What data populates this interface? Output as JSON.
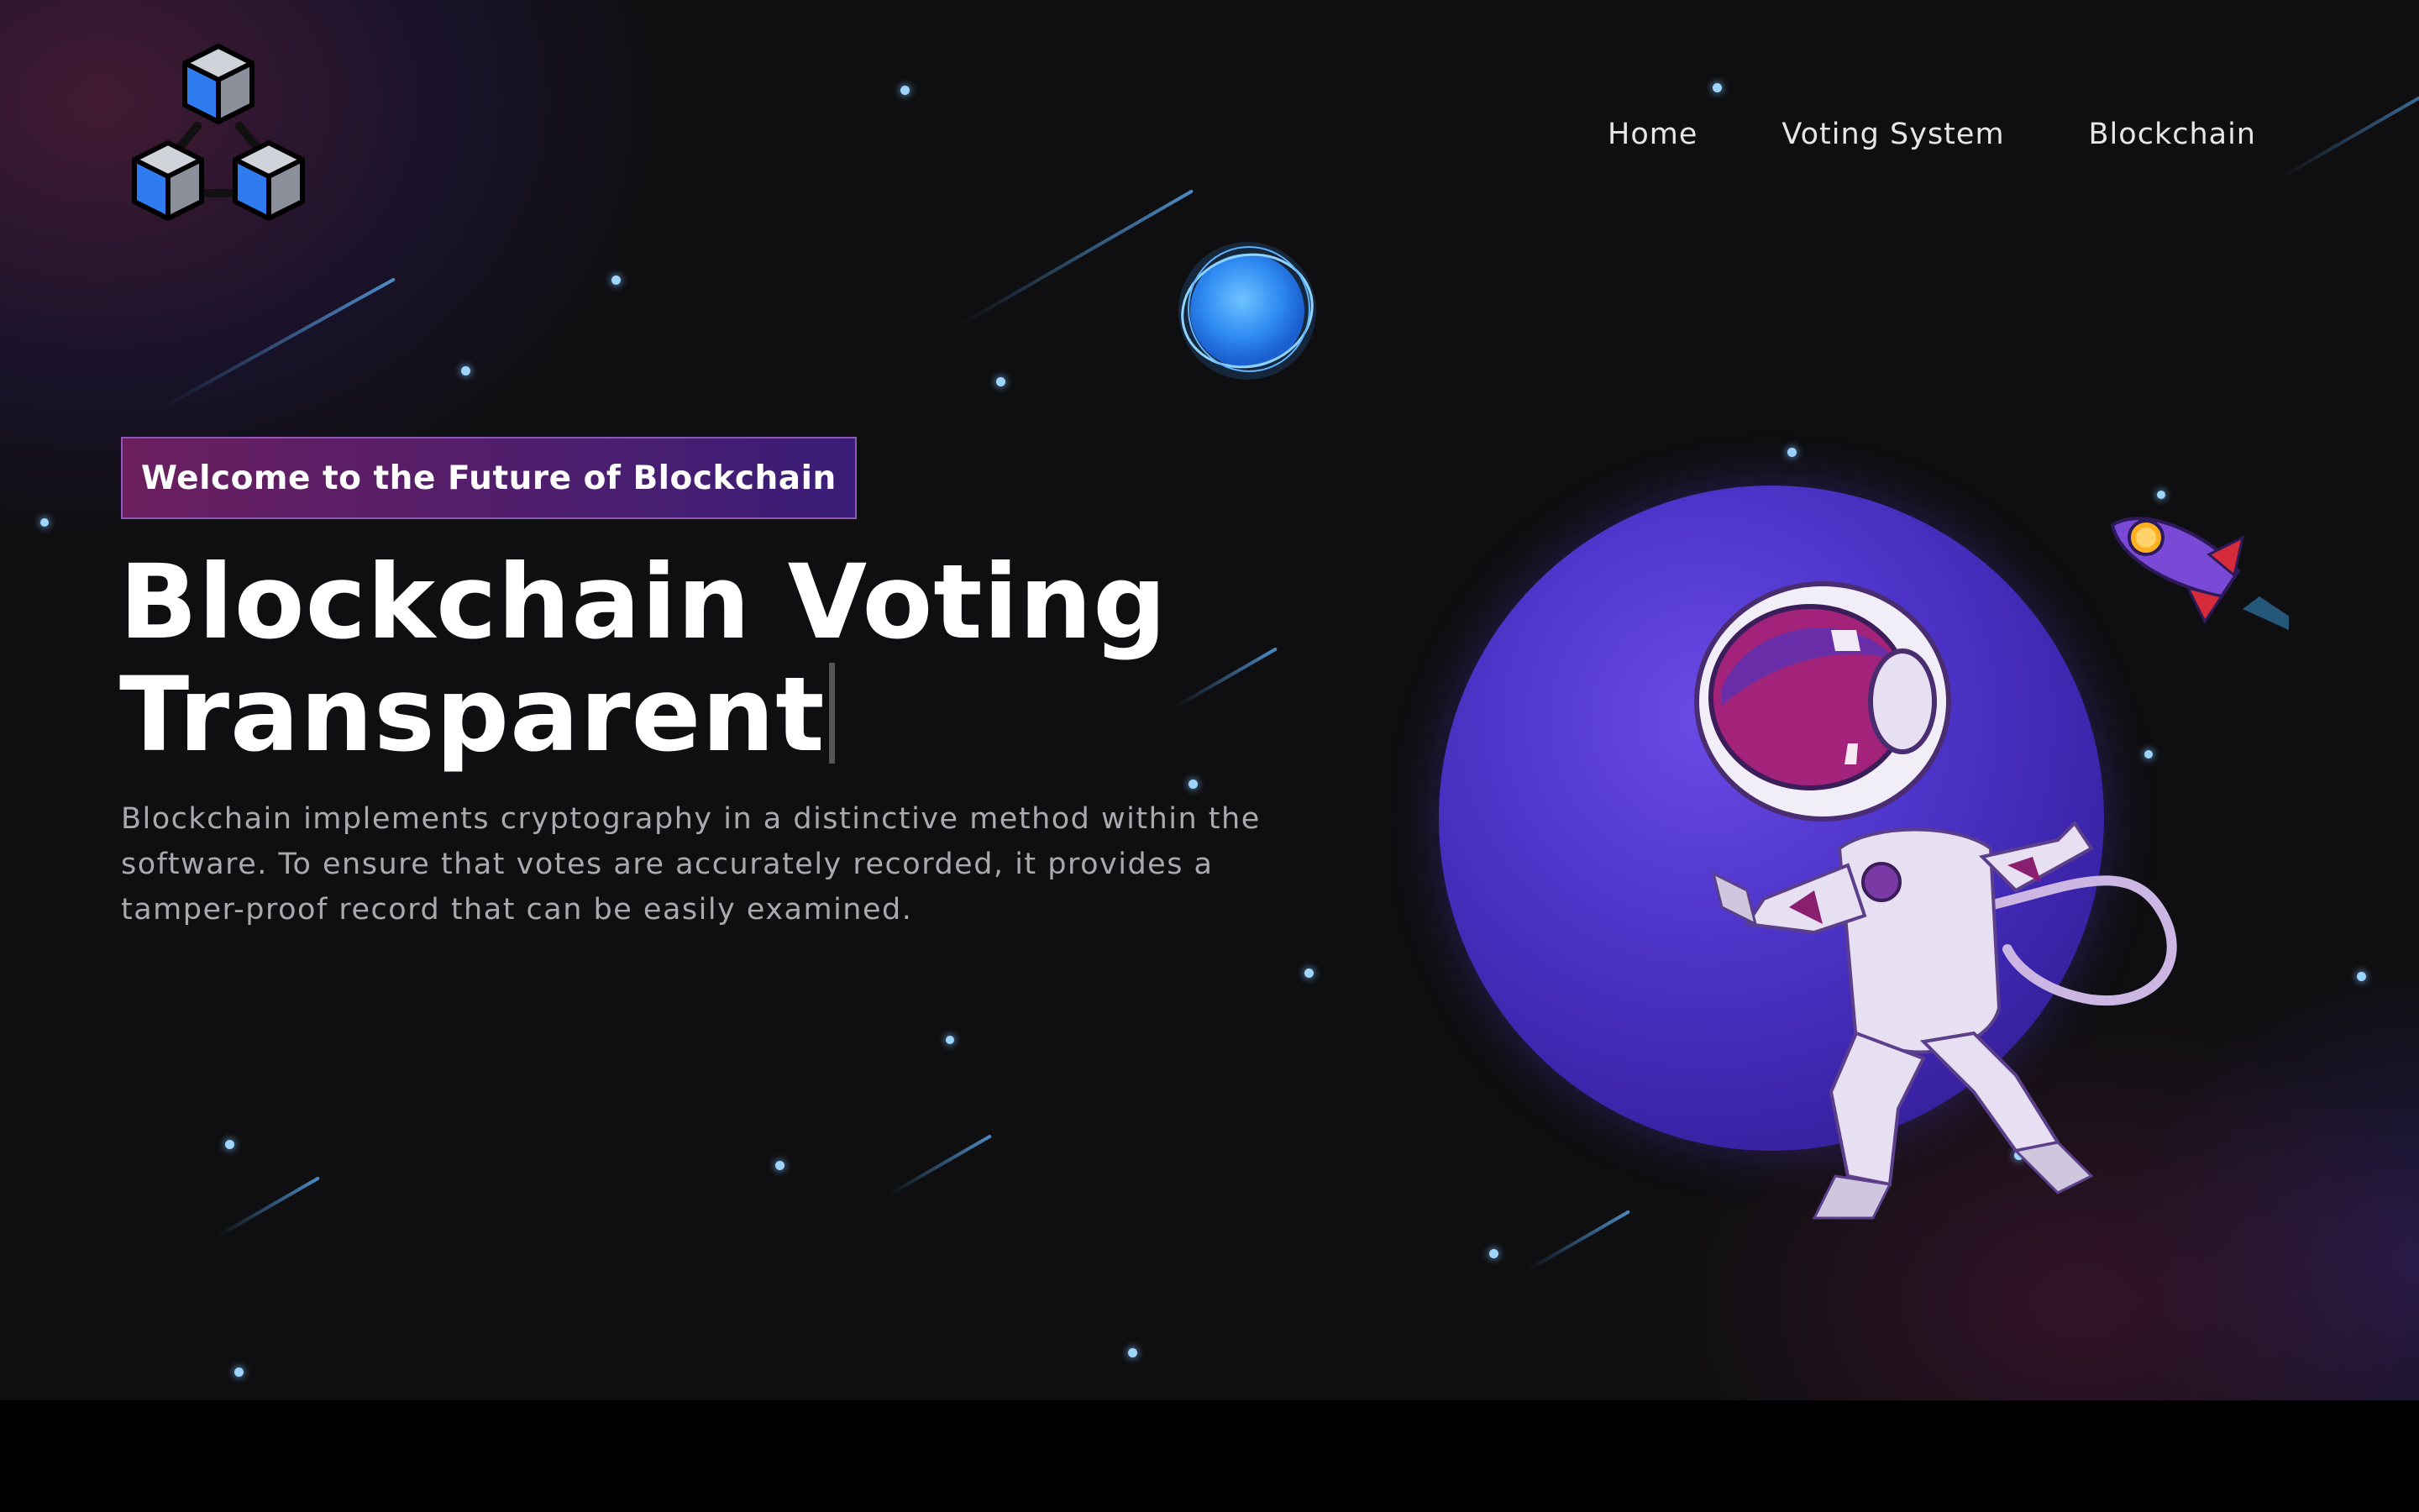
{
  "nav": {
    "items": [
      {
        "label": "Home"
      },
      {
        "label": "Voting System"
      },
      {
        "label": "Blockchain"
      }
    ]
  },
  "hero": {
    "badge": "Welcome to the Future of Blockchain",
    "title_line1": "Blockchain Voting",
    "title_line2": "Transparent",
    "description": "Blockchain implements cryptography in a distinctive method within the software. To ensure that votes are accurately recorded, it provides a tamper-proof record that can be easily examined."
  },
  "illustration": {
    "logo_icon": "blockchain-cubes-icon",
    "orb_icon": "blue-orb",
    "planet_icon": "purple-planet",
    "astronaut_icon": "astronaut",
    "rocket_icon": "rocket-icon"
  },
  "colors": {
    "background": "#0f0f11",
    "badge_start": "#6b1f5e",
    "badge_end": "#3a1d78",
    "planet": "#4f36cc",
    "text": "#ffffff",
    "muted_text": "#a9a9b0"
  }
}
